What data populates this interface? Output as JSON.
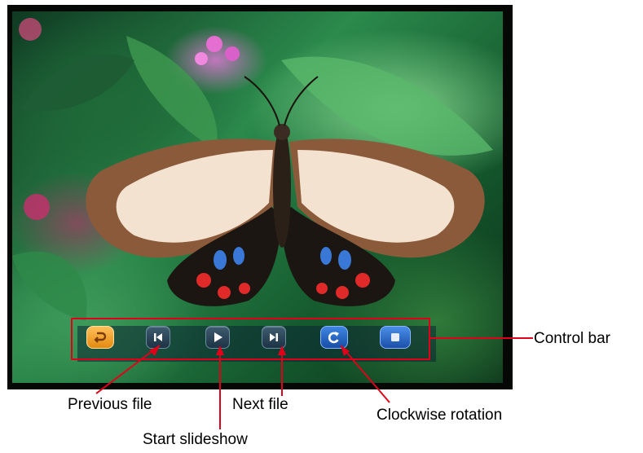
{
  "photo": {
    "subject": "butterfly-photo"
  },
  "controls": [
    {
      "name": "return-button",
      "icon": "return-icon"
    },
    {
      "name": "previous-file-button",
      "icon": "skip-previous-icon"
    },
    {
      "name": "start-slideshow-button",
      "icon": "play-icon"
    },
    {
      "name": "next-file-button",
      "icon": "skip-next-icon"
    },
    {
      "name": "rotate-clockwise-button",
      "icon": "rotate-clockwise-icon"
    },
    {
      "name": "stop-button",
      "icon": "stop-icon"
    }
  ],
  "callouts": {
    "control_bar": "Control bar",
    "previous_file": "Previous file",
    "start_slideshow": "Start slideshow",
    "next_file": "Next file",
    "clockwise_rotation": "Clockwise rotation"
  },
  "colors": {
    "callout_line": "#e1001a",
    "return_button": "#f2a032",
    "rotate_button": "#2a6fd0",
    "dark_button": "#2a4558"
  }
}
